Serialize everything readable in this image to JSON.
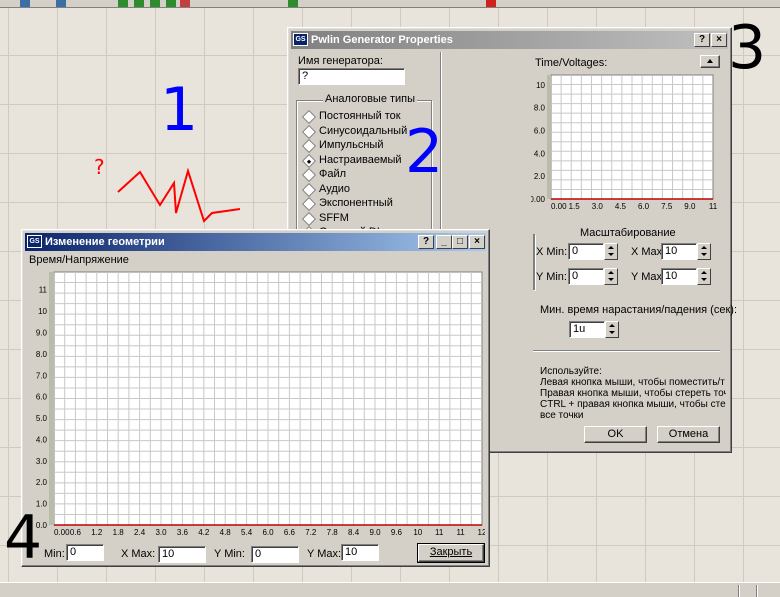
{
  "annotations": {
    "n1": "1",
    "n2": "2",
    "n3": "3",
    "n4": "4",
    "qmark": "?"
  },
  "pwlin": {
    "title": "Pwlin Generator Properties",
    "icon": "GS",
    "help_btn": "?",
    "close_btn": "×",
    "name_label": "Имя генератора:",
    "name_value": "?",
    "analog_group": "Аналоговые типы",
    "analog_types": [
      {
        "label": "Постоянный ток",
        "selected": false
      },
      {
        "label": "Синусоидальный",
        "selected": false
      },
      {
        "label": "Импульсный",
        "selected": false
      },
      {
        "label": "Настраиваемый",
        "selected": true
      },
      {
        "label": "Файл",
        "selected": false
      },
      {
        "label": "Аудио",
        "selected": false
      },
      {
        "label": "Экспонентный",
        "selected": false
      },
      {
        "label": "SFFM",
        "selected": false
      },
      {
        "label": "Опорный DL",
        "selected": false
      }
    ],
    "tv_label": "Time/Voltages:",
    "scale_group": "Масштабирование",
    "xmin_label": "X Min:",
    "xmin_value": "0",
    "xmax_label": "X Max:",
    "xmax_value": "10",
    "ymin_label": "Y Min:",
    "ymin_value": "0",
    "ymax_label": "Y Max:",
    "ymax_value": "10",
    "rise_label": "Мин. время нарастания/падения (сек):",
    "rise_value": "1u",
    "help_lines": [
      "Используйте:",
      "Левая кнопка мыши, чтобы поместить/т",
      "Правая кнопка мыши, чтобы стереть точ",
      "CTRL + правая кнопка мыши, чтобы стер",
      "все точки"
    ],
    "ok_label": "OK",
    "cancel_label": "Отмена"
  },
  "geom": {
    "title": "Изменение геометрии",
    "icon": "GS",
    "help_btn": "?",
    "min_btn": "_",
    "max_btn": "□",
    "close_btn": "×",
    "subtitle": "Время/Напряжение",
    "xmin_label": "Min:",
    "xmin_value": "0",
    "xmax_label": "X Max:",
    "xmax_value": "10",
    "ymin_label": "Y Min:",
    "ymin_value": "0",
    "ymax_label": "Y Max:",
    "ymax_value": "10",
    "close_label": "Закрыть"
  },
  "chart_data": [
    {
      "type": "line",
      "xlim": [
        0,
        12
      ],
      "ylim": [
        0,
        12
      ],
      "x_ticks": [
        "0.00",
        "1.5",
        "3.0",
        "4.5",
        "6.0",
        "7.5",
        "9.0",
        "11"
      ],
      "y_ticks": [
        "0.00",
        "2.0",
        "4.0",
        "6.0",
        "8.0",
        "10"
      ],
      "grid": true,
      "series": []
    },
    {
      "type": "line",
      "xlim": [
        0,
        12
      ],
      "ylim": [
        0,
        12
      ],
      "x_ticks": [
        "0.00",
        "0.6",
        "1.2",
        "1.8",
        "2.4",
        "3.0",
        "3.6",
        "4.2",
        "4.8",
        "5.4",
        "6.0",
        "6.6",
        "7.2",
        "7.8",
        "8.4",
        "9.0",
        "9.6",
        "10",
        "11",
        "11",
        "12"
      ],
      "y_ticks": [
        "0.0",
        "1.0",
        "2.0",
        "3.0",
        "4.0",
        "5.0",
        "6.0",
        "7.0",
        "8.0",
        "9.0",
        "10",
        "11"
      ],
      "grid": true,
      "series": []
    }
  ],
  "colors": {
    "annotation_blue": "#0000ff",
    "scribble_red": "#ff0000",
    "title_active": "#0a246a",
    "grid": "#c8c8c8"
  }
}
